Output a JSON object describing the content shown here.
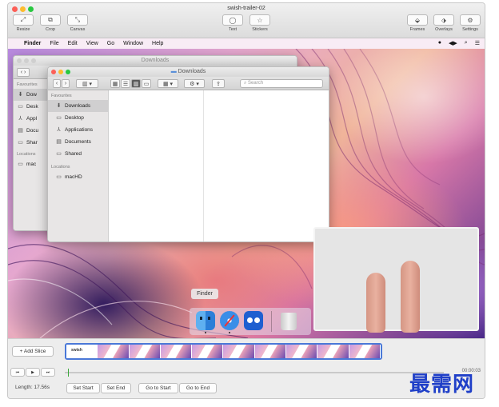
{
  "app": {
    "title": "swish-trailer-02",
    "toolbar_left": [
      {
        "label": "Resize",
        "glyph": "⤢"
      },
      {
        "label": "Crop",
        "glyph": "⧉"
      },
      {
        "label": "Canvas",
        "glyph": "⤡"
      }
    ],
    "toolbar_center": [
      {
        "label": "Text",
        "glyph": "◯"
      },
      {
        "label": "Stickers",
        "glyph": "☆"
      }
    ],
    "toolbar_right": [
      {
        "label": "Frames",
        "glyph": "⬙"
      },
      {
        "label": "Overlays",
        "glyph": "⬗"
      },
      {
        "label": "Settings",
        "glyph": "⚙"
      }
    ]
  },
  "menubar": {
    "apple": "",
    "items": [
      "Finder",
      "File",
      "Edit",
      "View",
      "Go",
      "Window",
      "Help"
    ],
    "status_icons": [
      "●",
      "◀▶",
      "⌕",
      "☰"
    ]
  },
  "finder_back": {
    "title": "Downloads",
    "sidebar_head": "Favourites",
    "items": [
      "Dow",
      "Desk",
      "Appl",
      "Docu",
      "Shar"
    ],
    "locations_head": "Locations",
    "locations": [
      "mac"
    ]
  },
  "finder_front": {
    "title": "Downloads",
    "search_placeholder": "Search",
    "favourites_head": "Favourites",
    "favourites": [
      {
        "label": "Downloads",
        "icon": "⬇",
        "selected": true
      },
      {
        "label": "Desktop",
        "icon": "▭",
        "selected": false
      },
      {
        "label": "Applications",
        "icon": "⅄",
        "selected": false
      },
      {
        "label": "Documents",
        "icon": "▤",
        "selected": false
      },
      {
        "label": "Shared",
        "icon": "▭",
        "selected": false
      }
    ],
    "locations_head": "Locations",
    "locations": [
      {
        "label": "macHD",
        "icon": "▭"
      }
    ]
  },
  "dock": {
    "tooltip": "Finder"
  },
  "timeline": {
    "add_slice": "+ Add Slice",
    "first_thumb_text": "swish",
    "thumb_count": 10,
    "transport": [
      "⏮",
      "▶",
      "⏭"
    ],
    "time_readout": "00:00:03",
    "length": "Length: 17.56s",
    "buttons": [
      "Set Start",
      "Set End",
      "Go to Start",
      "Go to End"
    ]
  },
  "watermark": "最需网"
}
